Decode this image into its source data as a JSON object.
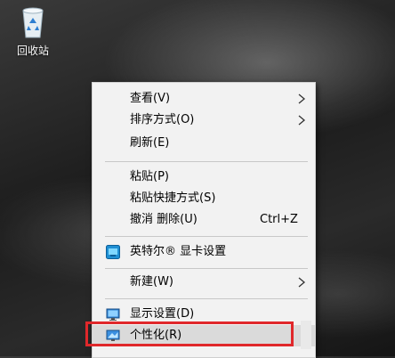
{
  "desktop": {
    "recycle_bin_label": "回收站"
  },
  "context_menu": {
    "view": "查看(V)",
    "sort_by": "排序方式(O)",
    "refresh": "刷新(E)",
    "paste": "粘贴(P)",
    "paste_shortcut": "粘贴快捷方式(S)",
    "undo_delete": "撤消 删除(U)",
    "undo_shortcut": "Ctrl+Z",
    "intel_graphics": "英特尔® 显卡设置",
    "new": "新建(W)",
    "display_settings": "显示设置(D)",
    "personalize": "个性化(R)"
  },
  "colors": {
    "menu_bg": "#f2f2f2",
    "highlight_border": "#e0282b",
    "hover_bg": "#dadada"
  }
}
